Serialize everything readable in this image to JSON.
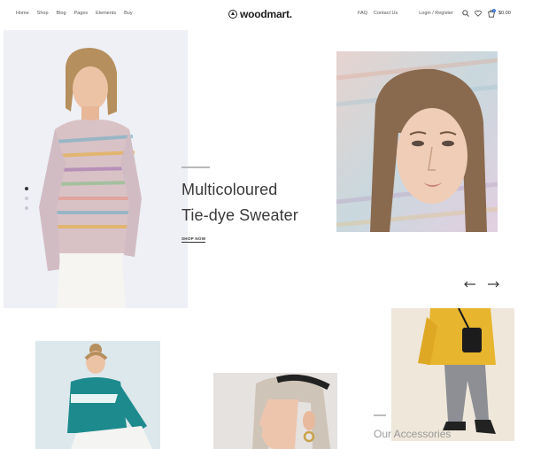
{
  "header": {
    "nav_left": [
      "Home",
      "Shop",
      "Blog",
      "Pages",
      "Elements",
      "Buy"
    ],
    "logo": "woodmart.",
    "nav_right": [
      "FAQ",
      "Contact Us",
      "Login / Register"
    ],
    "cart_total": "$0.00",
    "cart_count": "0"
  },
  "hero": {
    "title_line1": "Multicoloured",
    "title_line2": "Tie-dye Sweater",
    "cta": "SHOP NOW"
  },
  "accessories": {
    "label": "Our Accessories"
  },
  "icons": {
    "logo": "woodmart-logo-icon",
    "search": "search-icon",
    "wishlist": "heart-icon",
    "cart": "cart-icon",
    "prev": "arrow-left-icon",
    "next": "arrow-right-icon"
  },
  "colors": {
    "accent": "#1f5fd0",
    "text": "#2b2b2b",
    "hero_bg": "#eef0f5"
  }
}
